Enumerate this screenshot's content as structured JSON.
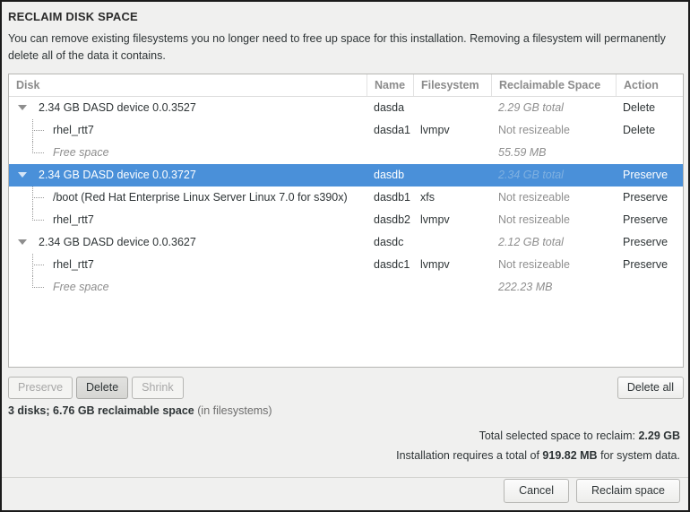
{
  "dialog": {
    "title": "RECLAIM DISK SPACE",
    "description": "You can remove existing filesystems you no longer need to free up space for this installation.  Removing a filesystem will permanently delete all of the data it contains."
  },
  "colors": {
    "selection": "#4a90d9",
    "window_bg": "#f0f0ef",
    "table_bg": "#ffffff",
    "muted_text": "#8e8e8e"
  },
  "table": {
    "columns": [
      {
        "key": "disk",
        "label": "Disk"
      },
      {
        "key": "name",
        "label": "Name"
      },
      {
        "key": "filesystem",
        "label": "Filesystem"
      },
      {
        "key": "space",
        "label": "Reclaimable Space"
      },
      {
        "key": "action",
        "label": "Action"
      }
    ],
    "rows": [
      {
        "level": "root",
        "expander": "triangle-down-icon",
        "disk": "2.34 GB DASD device 0.0.3527",
        "name": "dasda",
        "filesystem": "",
        "space": "2.29 GB total",
        "space_style": "italic",
        "action": "Delete",
        "selected": false,
        "guide": "none"
      },
      {
        "level": "child",
        "expander": "",
        "disk": "rhel_rtt7",
        "name": "dasda1",
        "filesystem": "lvmpv",
        "space": "Not resizeable",
        "space_style": "muted",
        "action": "Delete",
        "selected": false,
        "guide": "mid"
      },
      {
        "level": "child",
        "expander": "",
        "disk": "Free space",
        "disk_style": "italic",
        "name": "",
        "filesystem": "",
        "space": "55.59 MB",
        "space_style": "italic",
        "action": "",
        "selected": false,
        "guide": "last"
      },
      {
        "level": "root",
        "expander": "triangle-down-icon",
        "disk": "2.34 GB DASD device 0.0.3727",
        "name": "dasdb",
        "filesystem": "",
        "space": "2.34 GB total",
        "space_style": "italic",
        "action": "Preserve",
        "selected": true,
        "guide": "none"
      },
      {
        "level": "child",
        "expander": "",
        "disk": "/boot (Red Hat Enterprise Linux Server Linux 7.0 for s390x)",
        "name": "dasdb1",
        "filesystem": "xfs",
        "space": "Not resizeable",
        "space_style": "muted",
        "action": "Preserve",
        "selected": false,
        "guide": "mid"
      },
      {
        "level": "child",
        "expander": "",
        "disk": "rhel_rtt7",
        "name": "dasdb2",
        "filesystem": "lvmpv",
        "space": "Not resizeable",
        "space_style": "muted",
        "action": "Preserve",
        "selected": false,
        "guide": "last"
      },
      {
        "level": "root",
        "expander": "triangle-down-icon",
        "disk": "2.34 GB DASD device 0.0.3627",
        "name": "dasdc",
        "filesystem": "",
        "space": "2.12 GB total",
        "space_style": "italic",
        "action": "Preserve",
        "selected": false,
        "guide": "none"
      },
      {
        "level": "child",
        "expander": "",
        "disk": "rhel_rtt7",
        "name": "dasdc1",
        "filesystem": "lvmpv",
        "space": "Not resizeable",
        "space_style": "muted",
        "action": "Preserve",
        "selected": false,
        "guide": "mid"
      },
      {
        "level": "child",
        "expander": "",
        "disk": "Free space",
        "disk_style": "italic",
        "name": "",
        "filesystem": "",
        "space": "222.23 MB",
        "space_style": "italic",
        "action": "",
        "selected": false,
        "guide": "last"
      }
    ]
  },
  "action_bar": {
    "preserve_label": "Preserve",
    "preserve_enabled": false,
    "delete_label": "Delete",
    "delete_enabled": true,
    "shrink_label": "Shrink",
    "shrink_enabled": false,
    "delete_all_label": "Delete all"
  },
  "summary": {
    "bold": "3 disks; 6.76 GB reclaimable space",
    "paren": "(in filesystems)"
  },
  "totals": {
    "selected_prefix": "Total selected space to reclaim:",
    "selected_value": "2.29 GB",
    "required_prefix": "Installation requires a total of",
    "required_value": "919.82 MB",
    "required_suffix": "for system data."
  },
  "footer": {
    "cancel_label": "Cancel",
    "reclaim_label": "Reclaim space"
  }
}
